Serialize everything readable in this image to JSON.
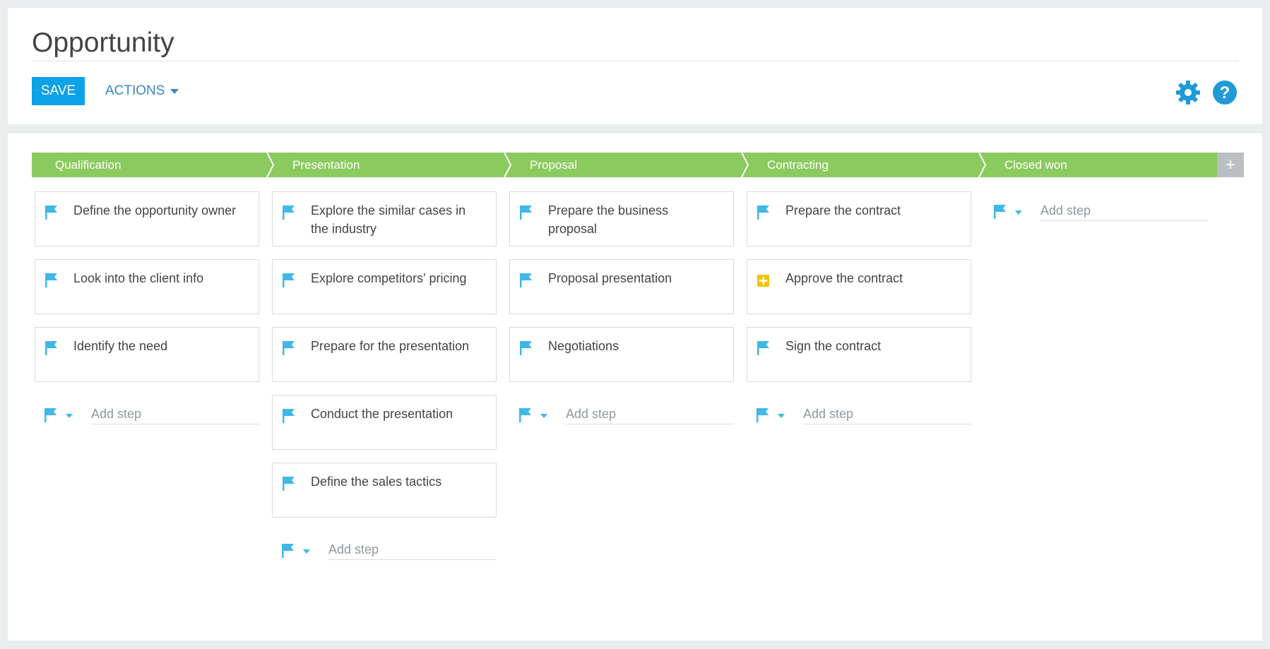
{
  "header": {
    "title": "Opportunity",
    "save_label": "SAVE",
    "actions_label": "ACTIONS"
  },
  "colors": {
    "stage_green": "#8bca5f",
    "save_blue": "#0ba2e8",
    "flag_blue": "#3fb7e8",
    "plus_yellow": "#f2c200",
    "icon_blue": "#1e9bd7"
  },
  "icons": {
    "settings": "gear-icon",
    "help": "help-icon",
    "step_flag": "flag-icon",
    "approval": "plus-square-icon"
  },
  "stages": [
    {
      "label": "Qualification",
      "steps": [
        {
          "text": "Define the opportunity owner",
          "icon": "flag"
        },
        {
          "text": "Look into the client info",
          "icon": "flag"
        },
        {
          "text": "Identify the need",
          "icon": "flag"
        }
      ],
      "add_placeholder": "Add step"
    },
    {
      "label": "Presentation",
      "steps": [
        {
          "text": "Explore the similar cases in the industry",
          "icon": "flag"
        },
        {
          "text": "Explore competitors' pricing",
          "icon": "flag"
        },
        {
          "text": "Prepare for the presentation",
          "icon": "flag"
        },
        {
          "text": "Conduct the presentation",
          "icon": "flag"
        },
        {
          "text": "Define the sales tactics",
          "icon": "flag"
        }
      ],
      "add_placeholder": "Add step"
    },
    {
      "label": "Proposal",
      "steps": [
        {
          "text": "Prepare the business proposal",
          "icon": "flag"
        },
        {
          "text": "Proposal presentation",
          "icon": "flag"
        },
        {
          "text": "Negotiations",
          "icon": "flag"
        }
      ],
      "add_placeholder": "Add step"
    },
    {
      "label": "Contracting",
      "steps": [
        {
          "text": "Prepare the contract",
          "icon": "flag"
        },
        {
          "text": "Approve the contract",
          "icon": "plus"
        },
        {
          "text": "Sign the contract",
          "icon": "flag"
        }
      ],
      "add_placeholder": "Add step"
    },
    {
      "label": "Closed won",
      "steps": [],
      "add_placeholder": "Add step"
    }
  ],
  "add_stage_label": "+"
}
